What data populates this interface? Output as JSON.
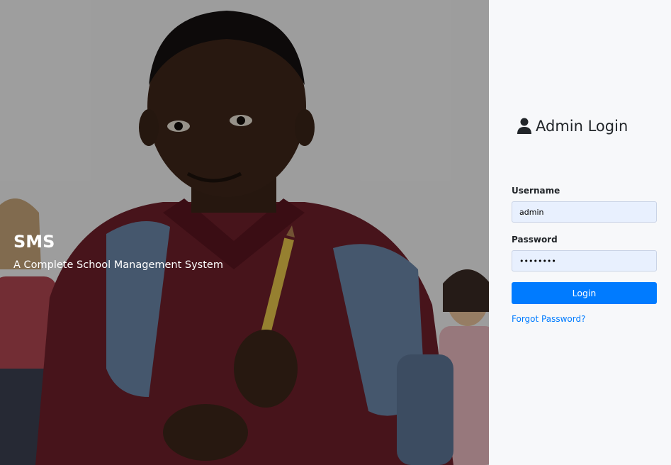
{
  "hero": {
    "brand": "SMS",
    "tagline": "A Complete School Management System"
  },
  "login": {
    "title": "Admin Login",
    "username_label": "Username",
    "username_value": "admin",
    "password_label": "Password",
    "password_value": "••••••••",
    "button_label": "Login",
    "forgot_label": "Forgot Password?"
  },
  "colors": {
    "accent": "#007bff",
    "panel_bg": "#f7f8fa",
    "input_bg": "#e8f0fe"
  },
  "icons": {
    "title_icon": "user-icon"
  }
}
